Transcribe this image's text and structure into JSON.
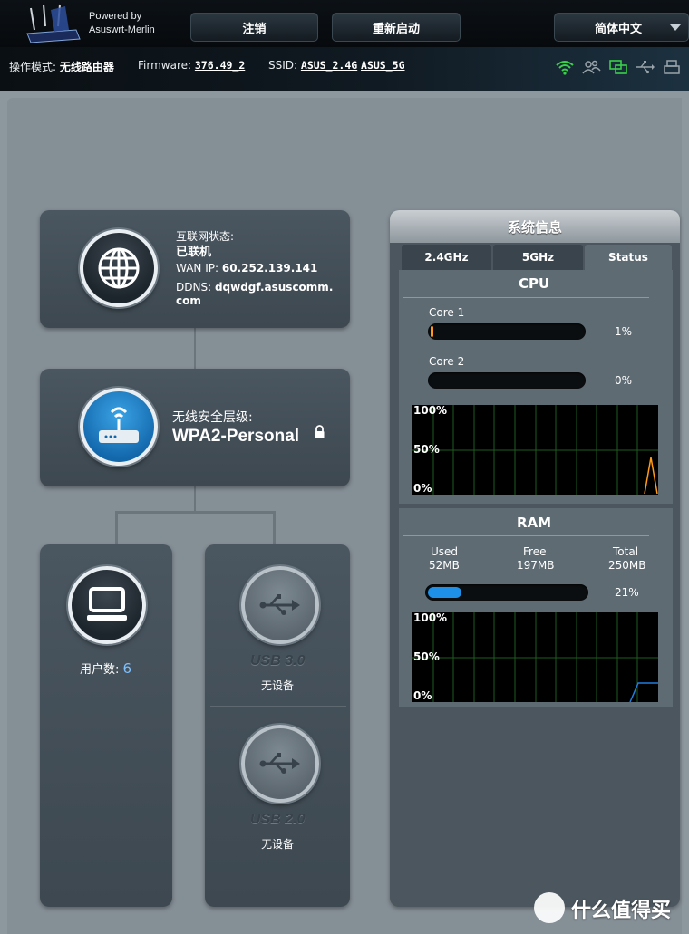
{
  "header": {
    "powered_line1": "Powered by",
    "powered_line2": "Asuswrt-Merlin",
    "logout_label": "注销",
    "reboot_label": "重新启动",
    "language_label": "简体中文"
  },
  "statusbar": {
    "mode_label": "操作模式:",
    "mode_value": "无线路由器",
    "firmware_label": "Firmware:",
    "firmware_value": "376.49_2",
    "ssid_label": "SSID:",
    "ssid_24": "ASUS_2.4G",
    "ssid_5": "ASUS_5G",
    "icons": [
      "wifi-icon",
      "clients-icon",
      "network-icon",
      "usb-icon",
      "printer-icon"
    ],
    "icon_colors": {
      "wifi": "#39d14a",
      "network": "#39d14a",
      "inactive": "#9aa4aa"
    }
  },
  "internet": {
    "status_label": "互联网状态:",
    "status_value": "已联机",
    "wan_label": "WAN IP:",
    "wan_value": "60.252.139.141",
    "ddns_label": "DDNS:",
    "ddns_value_line1": "dqwdgf.asuscomm.",
    "ddns_value_line2": "com"
  },
  "wireless": {
    "security_label": "无线安全层级:",
    "security_value": "WPA2-Personal"
  },
  "clients": {
    "label": "用户数:",
    "count": "6"
  },
  "usb": {
    "port1_name": "USB 3.0",
    "port1_status": "无设备",
    "port2_name": "USB 2.0",
    "port2_status": "无设备"
  },
  "sysinfo": {
    "title": "系统信息",
    "tabs": [
      "2.4GHz",
      "5GHz",
      "Status"
    ],
    "active_tab": "Status",
    "cpu": {
      "title": "CPU",
      "core1_label": "Core 1",
      "core1_value": "1%",
      "core1_fraction": 0.01,
      "core2_label": "Core 2",
      "core2_value": "0%",
      "core2_fraction": 0.0,
      "graph_labels": [
        "100%",
        "50%",
        "0%"
      ]
    },
    "ram": {
      "title": "RAM",
      "used_label": "Used",
      "used_value": "52MB",
      "free_label": "Free",
      "free_value": "197MB",
      "total_label": "Total",
      "total_value": "250MB",
      "usage_value": "21%",
      "usage_fraction": 0.21,
      "graph_labels": [
        "100%",
        "50%",
        "0%"
      ]
    }
  },
  "colors": {
    "cpu_line": "#ff9a1a",
    "ram_line": "#1e7fe0",
    "ram_bar": "#1e90e8",
    "grid": "#1e5a1e"
  },
  "watermark": "什么值得买"
}
